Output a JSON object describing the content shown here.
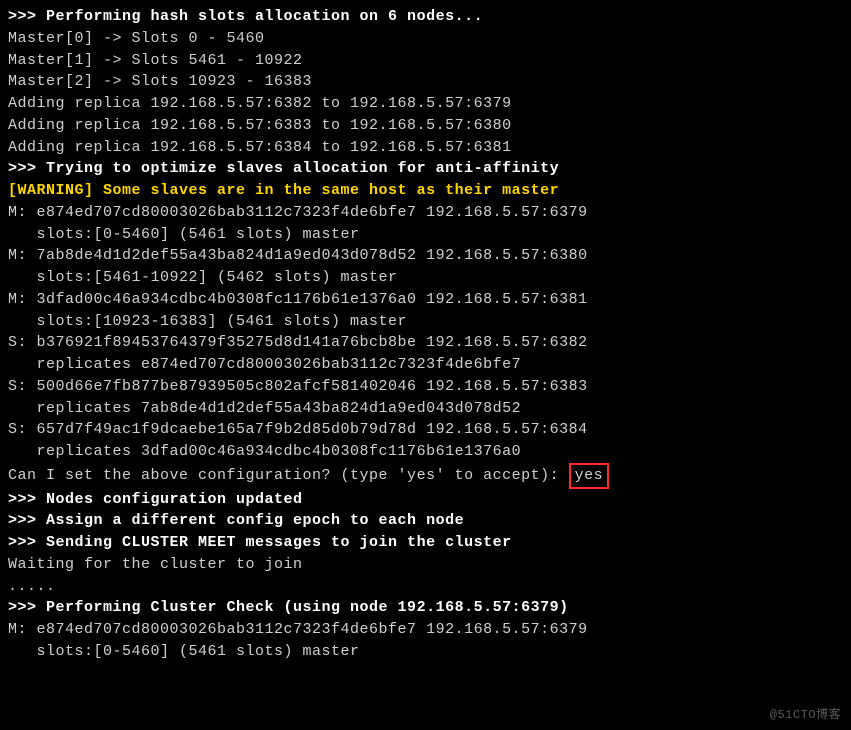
{
  "lines": {
    "l0": ">>> Performing hash slots allocation on 6 nodes...",
    "l1": "Master[0] -> Slots 0 - 5460",
    "l2": "Master[1] -> Slots 5461 - 10922",
    "l3": "Master[2] -> Slots 10923 - 16383",
    "l4": "Adding replica 192.168.5.57:6382 to 192.168.5.57:6379",
    "l5": "Adding replica 192.168.5.57:6383 to 192.168.5.57:6380",
    "l6": "Adding replica 192.168.5.57:6384 to 192.168.5.57:6381",
    "l7": ">>> Trying to optimize slaves allocation for anti-affinity",
    "l8": "[WARNING] Some slaves are in the same host as their master",
    "l9": "M: e874ed707cd80003026bab3112c7323f4de6bfe7 192.168.5.57:6379",
    "l10": "   slots:[0-5460] (5461 slots) master",
    "l11": "M: 7ab8de4d1d2def55a43ba824d1a9ed043d078d52 192.168.5.57:6380",
    "l12": "   slots:[5461-10922] (5462 slots) master",
    "l13": "M: 3dfad00c46a934cdbc4b0308fc1176b61e1376a0 192.168.5.57:6381",
    "l14": "   slots:[10923-16383] (5461 slots) master",
    "l15": "S: b376921f89453764379f35275d8d141a76bcb8be 192.168.5.57:6382",
    "l16": "   replicates e874ed707cd80003026bab3112c7323f4de6bfe7",
    "l17": "S: 500d66e7fb877be87939505c802afcf581402046 192.168.5.57:6383",
    "l18": "   replicates 7ab8de4d1d2def55a43ba824d1a9ed043d078d52",
    "l19": "S: 657d7f49ac1f9dcaebe165a7f9b2d85d0b79d78d 192.168.5.57:6384",
    "l20": "   replicates 3dfad00c46a934cdbc4b0308fc1176b61e1376a0",
    "prompt": "Can I set the above configuration? (type 'yes' to accept): ",
    "answer": "yes",
    "l22": ">>> Nodes configuration updated",
    "l23": ">>> Assign a different config epoch to each node",
    "l24": ">>> Sending CLUSTER MEET messages to join the cluster",
    "l25": "Waiting for the cluster to join",
    "l26": ".....",
    "l27": ">>> Performing Cluster Check (using node 192.168.5.57:6379)",
    "l28": "M: e874ed707cd80003026bab3112c7323f4de6bfe7 192.168.5.57:6379",
    "l29": "   slots:[0-5460] (5461 slots) master"
  },
  "watermark": "@51CTO博客"
}
